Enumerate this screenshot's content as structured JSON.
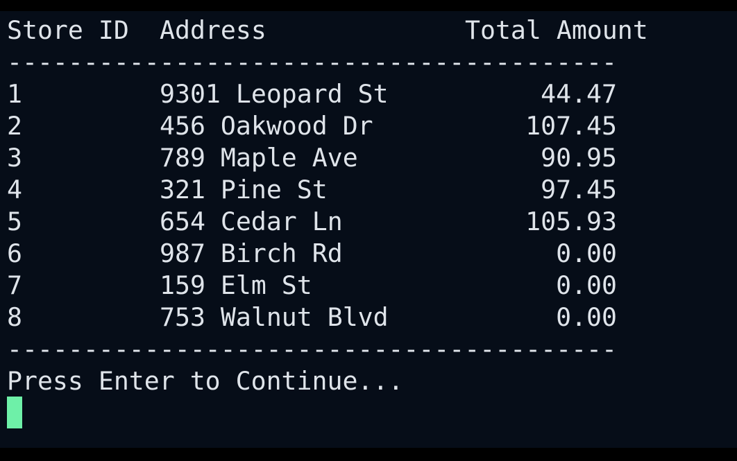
{
  "terminal": {
    "header": {
      "store_id": "Store ID",
      "address": "Address",
      "total_amount": "Total Amount"
    },
    "rule": "----------------------------------------",
    "rows": [
      {
        "id": "1",
        "address": "9301 Leopard St",
        "amount": "44.47"
      },
      {
        "id": "2",
        "address": "456 Oakwood Dr",
        "amount": "107.45"
      },
      {
        "id": "3",
        "address": "789 Maple Ave",
        "amount": "90.95"
      },
      {
        "id": "4",
        "address": "321 Pine St",
        "amount": "97.45"
      },
      {
        "id": "5",
        "address": "654 Cedar Ln",
        "amount": "105.93"
      },
      {
        "id": "6",
        "address": "987 Birch Rd",
        "amount": "0.00"
      },
      {
        "id": "7",
        "address": "159 Elm St",
        "amount": "0.00"
      },
      {
        "id": "8",
        "address": "753 Walnut Blvd",
        "amount": "0.00"
      }
    ],
    "prompt": "Press Enter to Continue...",
    "cursor_color": "#6ef0a8",
    "background_color": "#060d18",
    "text_color": "#dfe4ea"
  }
}
